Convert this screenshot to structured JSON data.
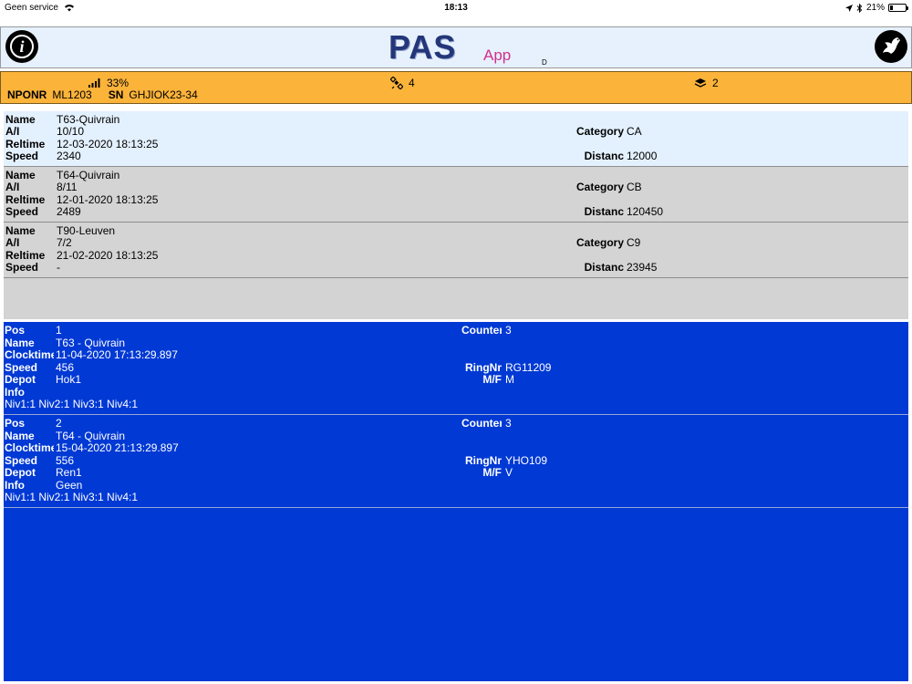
{
  "status_bar": {
    "carrier": "Geen service",
    "time": "18:13",
    "battery": "21%",
    "battery_level": 0.21
  },
  "header": {
    "logo_text": "PAS",
    "logo_sub": "App",
    "marker": "D"
  },
  "info_bar": {
    "signal": "33%",
    "satellites": "4",
    "stack": "2",
    "nponr_label": "NPONR",
    "nponr_value": "ML1203",
    "sn_label": "SN",
    "sn_value": "GHJIOK23-34"
  },
  "races": [
    {
      "name_label": "Name",
      "name": "T63-Quivrain",
      "ai_label": "A/I",
      "ai": "10/10",
      "reltime_label": "Reltime",
      "reltime": "12-03-2020 18:13:25",
      "speed_label": "Speed",
      "speed": "2340",
      "category_label": "Category",
      "category": "CA",
      "distance_label": "Distanc",
      "distance": "12000"
    },
    {
      "name_label": "Name",
      "name": "T64-Quivrain",
      "ai_label": "A/I",
      "ai": "8/11",
      "reltime_label": "Reltime",
      "reltime": "12-01-2020 18:13:25",
      "speed_label": "Speed",
      "speed": "2489",
      "category_label": "Category",
      "category": "CB",
      "distance_label": "Distanc",
      "distance": "120450"
    },
    {
      "name_label": "Name",
      "name": "T90-Leuven",
      "ai_label": "A/I",
      "ai": "7/2",
      "reltime_label": "Reltime",
      "reltime": "21-02-2020 18:13:25",
      "speed_label": "Speed",
      "speed": "-",
      "category_label": "Category",
      "category": "C9",
      "distance_label": "Distanc",
      "distance": "23945"
    }
  ],
  "results": [
    {
      "pos_label": "Pos",
      "pos": "1",
      "counter_label": "Counter",
      "counter": "3",
      "name_label": "Name",
      "name": "T63 - Quivrain",
      "clock_label": "Clocktime",
      "clock": "11-04-2020 17:13:29.897",
      "speed_label": "Speed",
      "speed": "456",
      "ring_label": "RingNr",
      "ring": "RG11209",
      "depot_label": "Depot",
      "depot": "Hok1",
      "mf_label": "M/F",
      "mf": "M",
      "info_label": "Info",
      "info": "",
      "levels": "Niv1:1 Niv2:1 Niv3:1 Niv4:1"
    },
    {
      "pos_label": "Pos",
      "pos": "2",
      "counter_label": "Counter",
      "counter": "3",
      "name_label": "Name",
      "name": "T64 - Quivrain",
      "clock_label": "Clocktime",
      "clock": "15-04-2020 21:13:29.897",
      "speed_label": "Speed",
      "speed": "556",
      "ring_label": "RingNr",
      "ring": "YHO109",
      "depot_label": "Depot",
      "depot": "Ren1",
      "mf_label": "M/F",
      "mf": "V",
      "info_label": "Info",
      "info": "Geen",
      "levels": "Niv1:1 Niv2:1 Niv3:1 Niv4:1"
    }
  ]
}
